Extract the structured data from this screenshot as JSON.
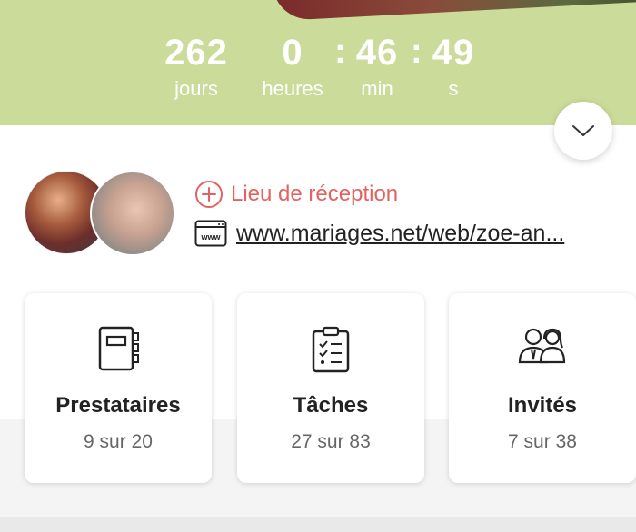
{
  "countdown": {
    "days": {
      "value": "262",
      "label": "jours"
    },
    "hours": {
      "value": "0",
      "label": "heures"
    },
    "minutes": {
      "value": "46",
      "label": "min"
    },
    "seconds": {
      "value": "49",
      "label": "s"
    },
    "separator": ":"
  },
  "profile": {
    "venue_label": "Lieu de réception",
    "website": "www.mariages.net/web/zoe-an..."
  },
  "cards": [
    {
      "title": "Prestataires",
      "subtitle": "9 sur 20",
      "icon": "notebook-icon"
    },
    {
      "title": "Tâches",
      "subtitle": "27 sur 83",
      "icon": "clipboard-checklist-icon"
    },
    {
      "title": "Invités",
      "subtitle": "7 sur 38",
      "icon": "guests-icon"
    }
  ],
  "colors": {
    "hero": "#cbdb9a",
    "accent": "#e3615f"
  }
}
